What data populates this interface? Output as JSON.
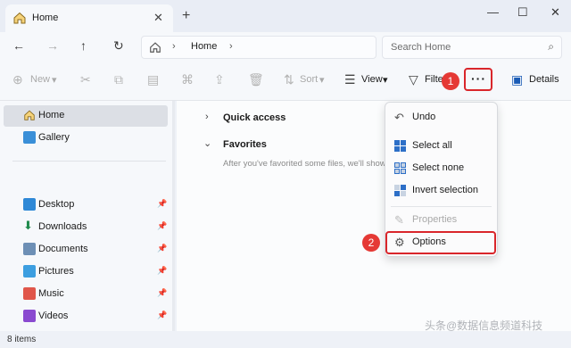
{
  "window": {
    "tab_title": "Home",
    "tab_close": "✕",
    "new_tab": "+",
    "minimize": "—",
    "maximize": "☐",
    "close": "✕"
  },
  "nav": {
    "back": "←",
    "forward": "→",
    "up": "↑",
    "refresh": "↻",
    "breadcrumb": [
      "Home"
    ],
    "crumb_sep": "›",
    "search_placeholder": "Search Home",
    "search_icon": "⌕"
  },
  "toolbar": {
    "new_label": "New",
    "sort_label": "Sort",
    "view_label": "View",
    "filter_label": "Filter",
    "more_label": "···",
    "details_label": "Details",
    "icons": [
      "cut-icon",
      "copy-icon",
      "paste-icon",
      "rename-icon",
      "share-icon",
      "delete-icon"
    ]
  },
  "annotations": {
    "badge1": "1",
    "badge2": "2",
    "accent_color": "#d9262b"
  },
  "sidebar": {
    "items": [
      {
        "label": "Home",
        "icon": "home-icon"
      },
      {
        "label": "Gallery",
        "icon": "gallery-icon"
      },
      {
        "label": "Desktop",
        "icon": "desktop-icon",
        "pinned": true
      },
      {
        "label": "Downloads",
        "icon": "downloads-icon",
        "pinned": true
      },
      {
        "label": "Documents",
        "icon": "documents-icon",
        "pinned": true
      },
      {
        "label": "Pictures",
        "icon": "pictures-icon",
        "pinned": true
      },
      {
        "label": "Music",
        "icon": "music-icon",
        "pinned": true
      },
      {
        "label": "Videos",
        "icon": "videos-icon",
        "pinned": true
      }
    ]
  },
  "main": {
    "quick_access": "Quick access",
    "favorites": "Favorites",
    "favorites_hint": "After you've favorited some files, we'll show"
  },
  "menu": {
    "items": [
      {
        "label": "Undo",
        "icon": "undo-icon",
        "enabled": true
      },
      {
        "label": "Select all",
        "icon": "select-all-icon",
        "enabled": true
      },
      {
        "label": "Select none",
        "icon": "select-none-icon",
        "enabled": true
      },
      {
        "label": "Invert selection",
        "icon": "invert-selection-icon",
        "enabled": true
      },
      {
        "label": "Properties",
        "icon": "properties-icon",
        "enabled": false
      },
      {
        "label": "Options",
        "icon": "options-icon",
        "enabled": true
      }
    ]
  },
  "status": {
    "item_count": "8 items"
  },
  "watermark": "头条@数据信息频道科技"
}
